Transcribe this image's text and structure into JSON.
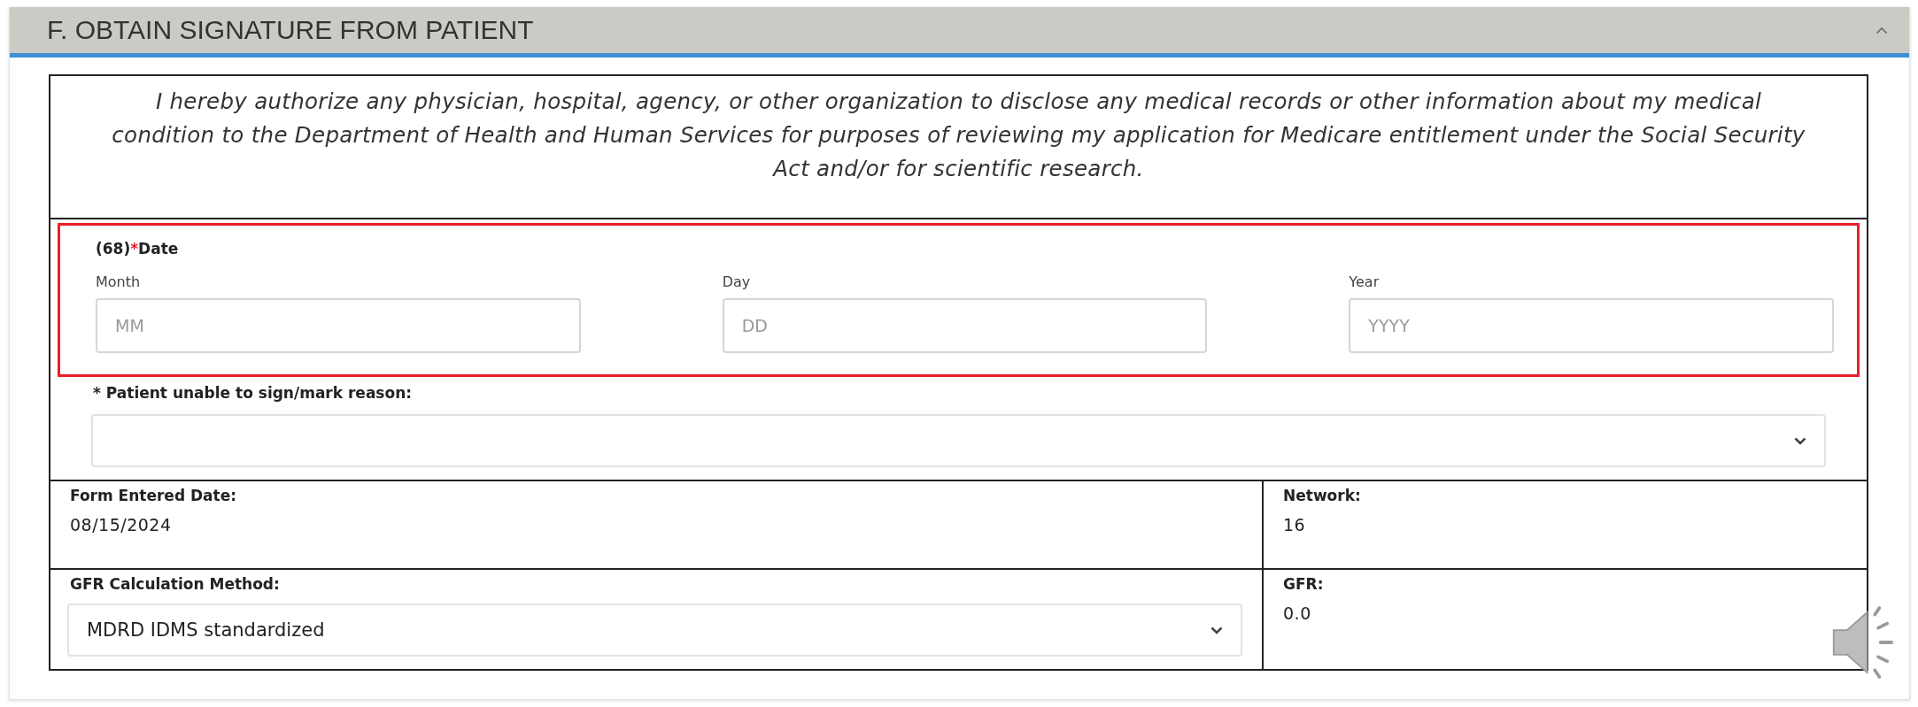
{
  "section": {
    "title": "F. OBTAIN SIGNATURE FROM PATIENT",
    "expanded": true
  },
  "authorization_text": "I hereby authorize any physician, hospital, agency, or other organization to disclose any medical records or other information about my medical condition to the Department of Health and Human Services for purposes of reviewing my application for Medicare entitlement under the Social Security Act and/or for scientific research.",
  "date_field": {
    "number": "(68)",
    "required_mark": "*",
    "label": "Date",
    "highlighted": true,
    "parts": [
      {
        "label": "Month",
        "placeholder": "MM"
      },
      {
        "label": "Day",
        "placeholder": "DD"
      },
      {
        "label": "Year",
        "placeholder": "YYYY"
      }
    ]
  },
  "unable_reason": {
    "label": "* Patient unable to sign/mark reason:"
  },
  "info_rows": [
    {
      "left": {
        "label": "Form Entered Date:",
        "kind": "text",
        "value": "08/15/2024"
      },
      "right": {
        "label": "Network:",
        "value": "16"
      }
    },
    {
      "left": {
        "label": "GFR Calculation Method:",
        "kind": "select",
        "value": "MDRD IDMS standardized"
      },
      "right": {
        "label": "GFR:",
        "value": "0.0"
      }
    }
  ]
}
